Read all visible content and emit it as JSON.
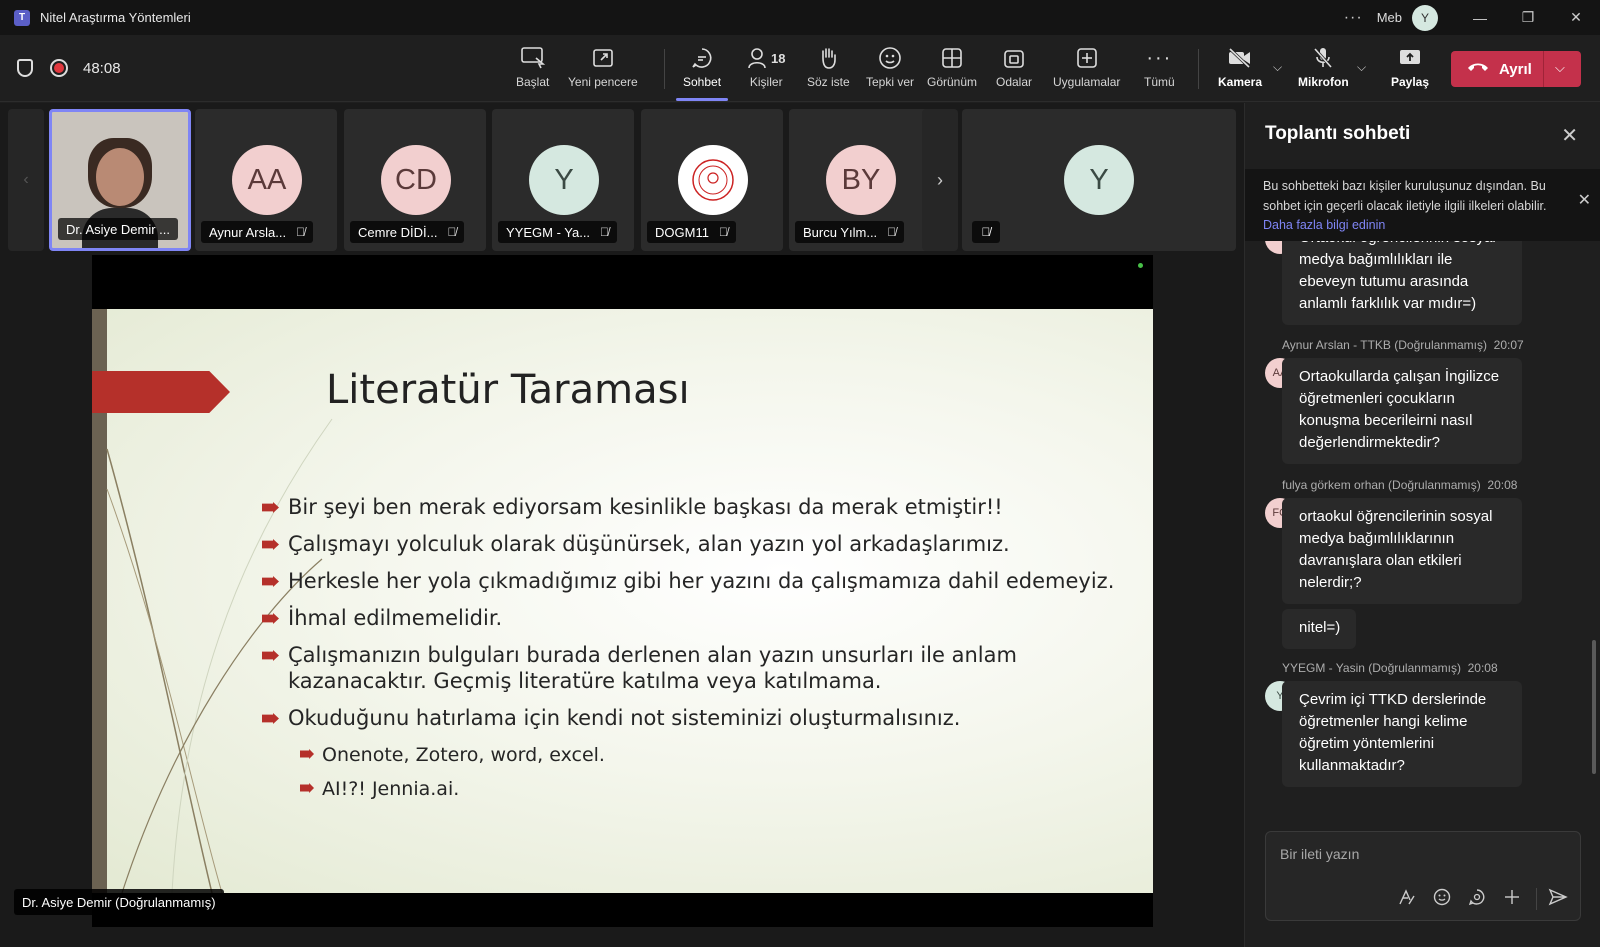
{
  "window": {
    "title": "Nitel Araştırma Yöntemleri",
    "org": "Meb",
    "user_initial": "Y"
  },
  "toolbar": {
    "timer": "48:08",
    "buttons": {
      "start": "Başlat",
      "new_window": "Yeni pencere",
      "chat": "Sohbet",
      "people": "Kişiler",
      "people_count": "18",
      "raise_hand": "Söz iste",
      "react": "Tepki ver",
      "view": "Görünüm",
      "rooms": "Odalar",
      "apps": "Uygulamalar",
      "more": "Tümü",
      "camera": "Kamera",
      "mic": "Mikrofon",
      "share": "Paylaş"
    },
    "leave": "Ayrıl"
  },
  "participants": [
    {
      "name": "Dr. Asiye Demir ...",
      "initials": "",
      "color": "#c9c4bd"
    },
    {
      "name": "Aynur Arsla...",
      "initials": "AA",
      "color": "#f2cfcf"
    },
    {
      "name": "Cemre DİDİ...",
      "initials": "CD",
      "color": "#f2cfcf"
    },
    {
      "name": "YYEGM - Ya...",
      "initials": "Y",
      "color": "#d5e8e0"
    },
    {
      "name": "DOGM11",
      "initials": "",
      "color": "#ffffff"
    },
    {
      "name": "Burcu Yılm...",
      "initials": "BY",
      "color": "#f2cfcf"
    }
  ],
  "extra_tile": {
    "initials": "Y"
  },
  "slide": {
    "title": "Literatür Taraması",
    "bullets": [
      "Bir şeyi ben merak ediyorsam kesinlikle başkası da merak etmiştir!!",
      "Çalışmayı yolculuk olarak düşünürsek, alan yazın yol arkadaşlarımız.",
      "Herkesle her yola çıkmadığımız gibi her yazını da çalışmamıza dahil edemeyiz.",
      "İhmal edilmemelidir.",
      "Çalışmanızın bulguları burada derlenen alan yazın unsurları ile anlam kazanacaktır. Geçmiş literatüre katılma veya katılmama.",
      "Okuduğunu hatırlama için kendi not sisteminizi oluşturmalısınız."
    ],
    "sub_bullets": [
      "Onenote, Zotero, word, excel.",
      "AI!?! Jennia.ai."
    ]
  },
  "speaker_label": "Dr. Asiye Demir (Doğrulanmamış)",
  "chat": {
    "title": "Toplantı sohbeti",
    "notice": "Bu sohbetteki bazı kişiler kuruluşunuz dışından. Bu sohbet için geçerli olacak iletiyle ilgili ilkeleri olabilir.",
    "notice_link": "Daha fazla bilgi edinin",
    "messages": [
      {
        "author": "",
        "time": "",
        "initials": "",
        "text": "Ortaokul öğrencilerinin sosyal medya bağımlılıkları ile ebeveyn tutumu arasında anlamlı farklılık var mıdır=)"
      },
      {
        "author": "Aynur Arslan - TTKB (Doğrulanmamış)",
        "time": "20:07",
        "initials": "AA",
        "text": "Ortaokullarda çalışan İngilizce öğretmenleri çocukların konuşma becerileirni nasıl değerlendirmektedir?"
      },
      {
        "author": "fulya görkem orhan (Doğrulanmamış)",
        "time": "20:08",
        "initials": "FO",
        "text": "ortaokul öğrencilerinin sosyal medya bağımlılıklarının davranışlara olan etkileri nelerdir;?",
        "followup": "nitel=)"
      },
      {
        "author": "YYEGM - Yasin (Doğrulanmamış)",
        "time": "20:08",
        "initials": "Y",
        "text": "Çevrim içi TTKD derslerinde öğretmenler hangi kelime öğretim yöntemlerini kullanmaktadır?"
      }
    ],
    "composer_placeholder": "Bir ileti yazın"
  },
  "colors": {
    "accent": "#7f85f5",
    "leave": "#c4314b",
    "slide_accent": "#b5302a"
  }
}
